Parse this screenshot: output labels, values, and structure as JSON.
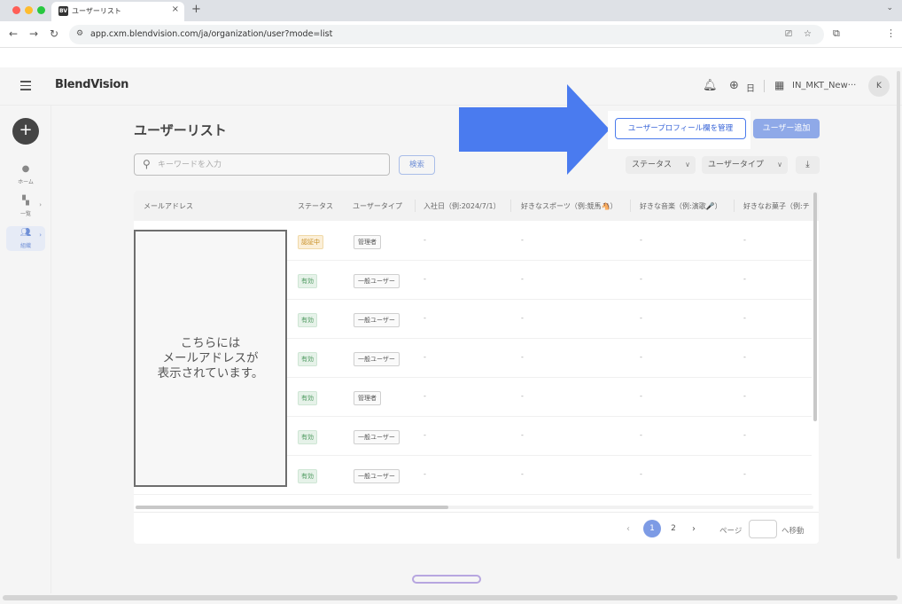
{
  "browser": {
    "tab_favicon": "BV",
    "tab_title": "ユーザーリスト",
    "tab_close": "×",
    "new_tab": "+",
    "url": "app.cxm.blendvision.com/ja/organization/user?mode=list",
    "icons": [
      "back-icon",
      "forward-icon",
      "reload-icon",
      "site-info-icon",
      "cast-icon",
      "star-icon",
      "extensions-icon",
      "menu-icon"
    ]
  },
  "header": {
    "logo": "BlendVision",
    "language": "日",
    "organization": "IN_MKT_New···",
    "avatar": "K"
  },
  "sidebar": {
    "add_label": "+",
    "items": [
      {
        "label": "ホーム",
        "icon": "home-icon"
      },
      {
        "label": "一覧",
        "icon": "grid-icon"
      },
      {
        "label": "組織",
        "icon": "users-icon"
      }
    ]
  },
  "main": {
    "title": "ユーザーリスト",
    "manage_profile_button": "ユーザープロフィール欄を管理",
    "add_user_button": "ユーザー追加",
    "search_placeholder": "キーワードを入力",
    "search_button": "検索",
    "status_filter": "ステータス",
    "user_type_filter": "ユーザータイプ"
  },
  "table": {
    "columns": [
      "メールアドレス",
      "ステータス",
      "ユーザータイプ",
      "入社日（例:2024/7/1）",
      "好きなスポーツ（例:競馬🐴）",
      "好きな音楽（例:演歌🎤）",
      "好きなお菓子（例:チ"
    ],
    "rows": [
      {
        "status": "認証中",
        "status_kind": "pending",
        "type": "管理者",
        "join": "-",
        "sport": "-",
        "music": "-",
        "snack": "-"
      },
      {
        "status": "有効",
        "status_kind": "valid",
        "type": "一般ユーザー",
        "join": "-",
        "sport": "-",
        "music": "-",
        "snack": "-"
      },
      {
        "status": "有効",
        "status_kind": "valid",
        "type": "一般ユーザー",
        "join": "-",
        "sport": "-",
        "music": "-",
        "snack": "-"
      },
      {
        "status": "有効",
        "status_kind": "valid",
        "type": "一般ユーザー",
        "join": "-",
        "sport": "-",
        "music": "-",
        "snack": "-"
      },
      {
        "status": "有効",
        "status_kind": "valid",
        "type": "管理者",
        "join": "-",
        "sport": "-",
        "music": "-",
        "snack": "-"
      },
      {
        "status": "有効",
        "status_kind": "valid",
        "type": "一般ユーザー",
        "join": "-",
        "sport": "-",
        "music": "-",
        "snack": "-"
      },
      {
        "status": "有効",
        "status_kind": "valid",
        "type": "一般ユーザー",
        "join": "-",
        "sport": "-",
        "music": "-",
        "snack": "-"
      }
    ]
  },
  "pagination": {
    "pages": [
      "1",
      "2"
    ],
    "current": "1",
    "page_label": "ページ",
    "goto_label": "へ移動"
  },
  "annotation": {
    "email_cover_lines": [
      "こちらには",
      "メールアドレスが",
      "表示されています。"
    ],
    "arrow_color": "#4a7bef"
  },
  "colors": {
    "accent": "#4b7bec",
    "pending": "#c68a1c",
    "valid": "#4f9a60"
  }
}
